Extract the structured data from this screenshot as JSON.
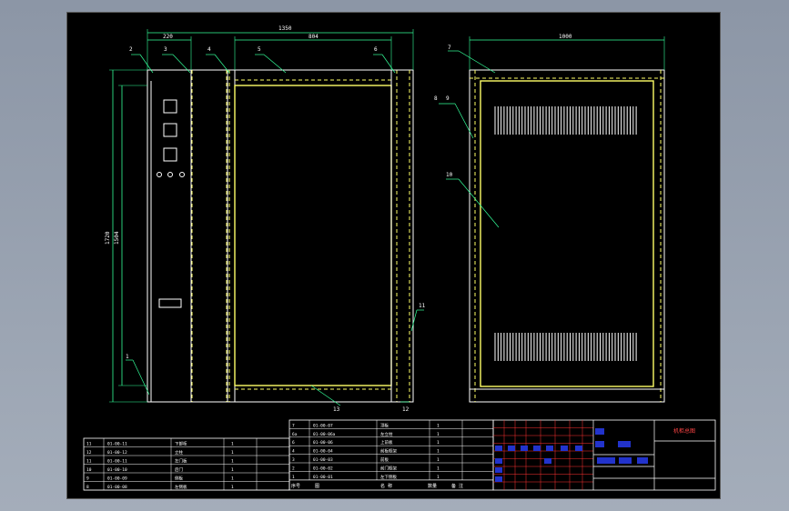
{
  "colors": {
    "background": "#000000",
    "outline": "#ffffff",
    "highlight": "#ffff66",
    "dimension": "#33ff99",
    "leader": "#33ff99",
    "table_fill": "#2233cc",
    "table_red": "#ff3333"
  },
  "dimensions": {
    "overall_width": "1350",
    "left_section_width": "220",
    "door_width": "804",
    "overall_height": "1720",
    "inner_height": "1504",
    "side_width": "1000"
  },
  "part_numbers": {
    "p1": "1",
    "p2": "2",
    "p3": "3",
    "p4": "4",
    "p5": "5",
    "p6": "6",
    "p7": "7",
    "p8": "8",
    "p9": "9",
    "p10": "10",
    "p11": "11",
    "p12": "12",
    "p13": "13"
  },
  "bom_left": [
    {
      "no": "11",
      "code": "01-00-11",
      "name": "下部柜",
      "qty": "1"
    },
    {
      "no": "12",
      "code": "01-00-12",
      "name": "立柱",
      "qty": "1"
    },
    {
      "no": "11",
      "code": "01-00-11",
      "name": "左门板",
      "qty": "1"
    },
    {
      "no": "10",
      "code": "01-00-10",
      "name": "后门",
      "qty": "1"
    },
    {
      "no": "9",
      "code": "01-00-09",
      "name": "侧板",
      "qty": "1"
    },
    {
      "no": "8",
      "code": "01-00-08",
      "name": "左侧板",
      "qty": "1"
    }
  ],
  "bom_right": [
    {
      "no": "7",
      "code": "01-00-07",
      "name": "顶板",
      "qty": "1"
    },
    {
      "no": "6a",
      "code": "01-00-06a",
      "name": "左立柱",
      "qty": "1"
    },
    {
      "no": "6",
      "code": "01-00-06",
      "name": "上前板",
      "qty": "1"
    },
    {
      "no": "4",
      "code": "01-00-04",
      "name": "前板框架",
      "qty": "1"
    },
    {
      "no": "3",
      "code": "01-00-03",
      "name": "前板",
      "qty": "1"
    },
    {
      "no": "2",
      "code": "01-00-02",
      "name": "前门框架",
      "qty": "1"
    },
    {
      "no": "1",
      "code": "01-00-01",
      "name": "左下侧板",
      "qty": "1"
    }
  ],
  "bom_header": {
    "col_no": "序号",
    "col_code": "图",
    "col_name": "名 称",
    "col_qty": "数量",
    "col_note": "备 注"
  },
  "title_block": {
    "drawing_title": "机柜总图",
    "scale_label": "比例",
    "material_label": "材料",
    "sheet_label": "共 张"
  }
}
